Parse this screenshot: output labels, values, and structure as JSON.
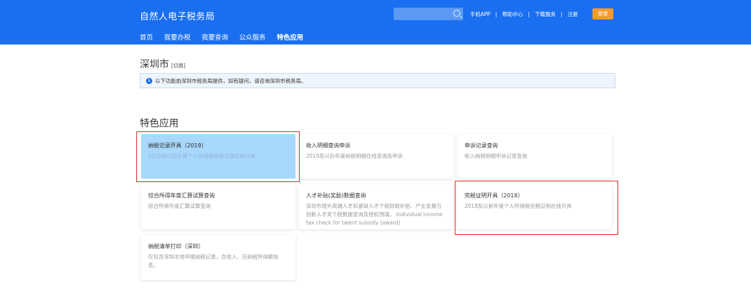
{
  "header": {
    "logo": "自然人电子税务局",
    "links": [
      "手机APP",
      "帮助中心",
      "下载服务",
      "注册"
    ],
    "login": "登录",
    "nav": [
      "首页",
      "我要办税",
      "我要查询",
      "公众服务",
      "特色应用"
    ],
    "active_nav": "特色应用",
    "background_color": "#1a6ff0"
  },
  "city": {
    "name": "深圳市",
    "switch": "[切换]"
  },
  "notice": "以下功能由深圳市税务局提供，如有疑问，请咨询深圳市税务局。",
  "section_title": "特色应用",
  "cards": [
    {
      "title": "纳税记录开具（2019）",
      "desc": "2019及以后年度个人所得税纳税记录在线开具",
      "highlighted": true
    },
    {
      "title": "收入明细查询申诉",
      "desc": "2019及以后年度纳税明细在线查询及申诉"
    },
    {
      "title": "申诉记录查询",
      "desc": "收入纳税明细申诉记录查询"
    },
    {
      "title": "综合所得年度汇算试算查询",
      "desc": "综合所得年度汇算试算查询"
    },
    {
      "title": "人才补贴(奖励)数据查询",
      "desc": "深圳市境外高端人才和紧缺人才个税财政补贴、产业发展与创新人才奖个税数据查询及授权预填。 Individual income tax check for talent subsidy (award)"
    },
    {
      "title": "完税证明开具（2018）",
      "desc": "2018及以前年度个人所得税完税证明在线开具"
    },
    {
      "title": "纳税清单打印（深圳）",
      "desc": "仅包含深圳本地申报纳税记录，含收入、应纳税所得额信息。"
    }
  ]
}
